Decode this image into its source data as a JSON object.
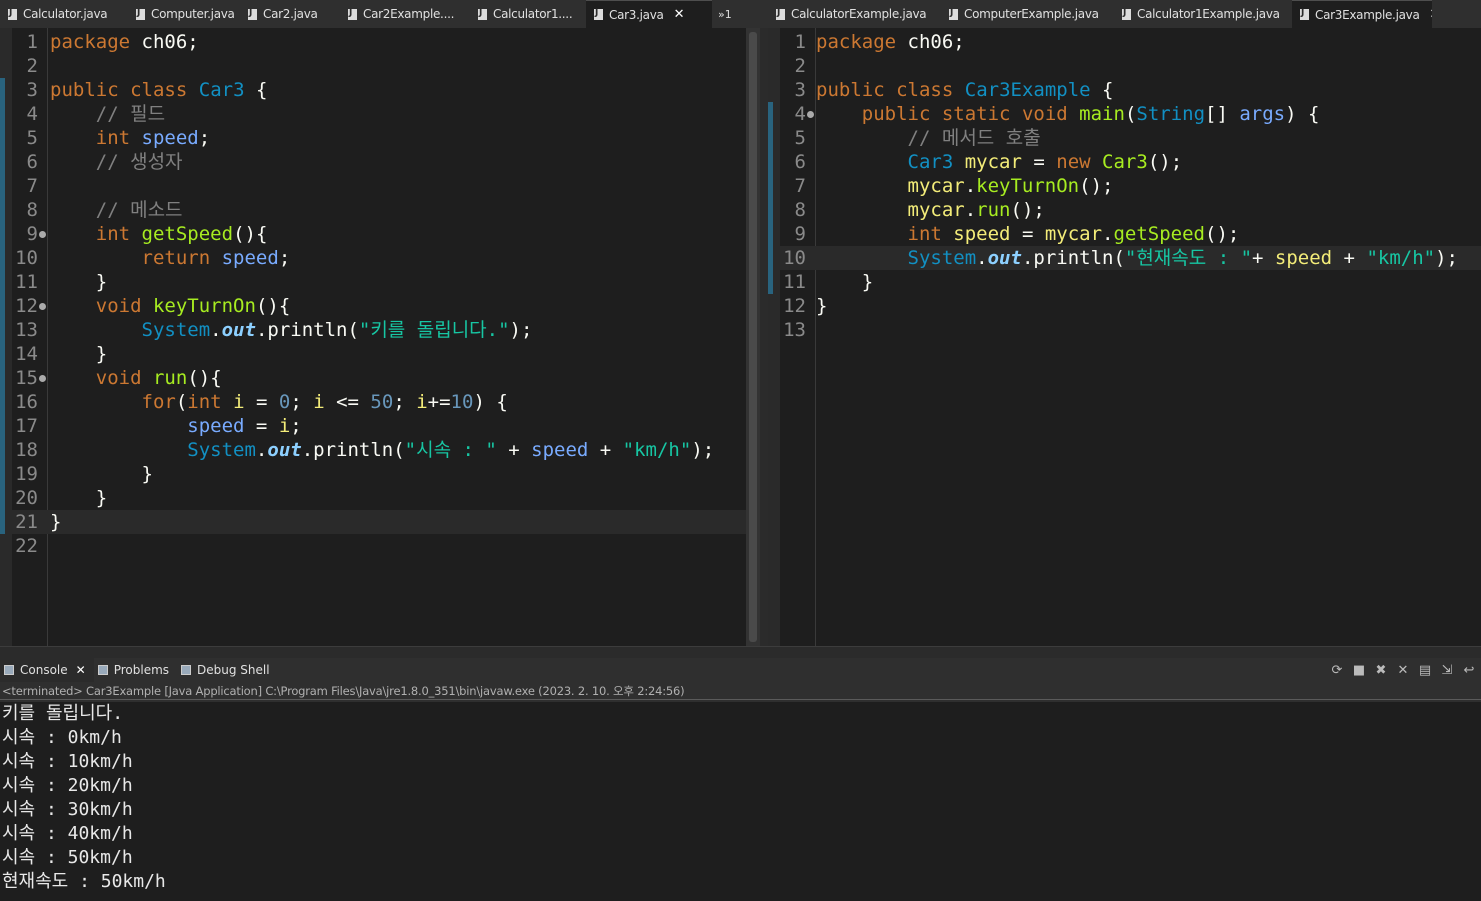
{
  "left_tabs": [
    {
      "label": "Calculator.java",
      "active": false
    },
    {
      "label": "Computer.java",
      "active": false
    },
    {
      "label": "Car2.java",
      "active": false
    },
    {
      "label": "Car2Example....",
      "active": false
    },
    {
      "label": "Calculator1....",
      "active": false
    },
    {
      "label": "Car3.java",
      "active": true
    }
  ],
  "left_more": "»1",
  "right_tabs": [
    {
      "label": "CalculatorExample.java",
      "active": false
    },
    {
      "label": "ComputerExample.java",
      "active": false
    },
    {
      "label": "Calculator1Example.java",
      "active": false
    },
    {
      "label": "Car3Example.java",
      "active": true
    }
  ],
  "left_editor": {
    "current_line": 21,
    "lines": [
      {
        "n": "1",
        "fold": false,
        "tokens": [
          [
            "k",
            "package"
          ],
          [
            "p",
            " ch06;"
          ]
        ]
      },
      {
        "n": "2",
        "fold": false,
        "tokens": []
      },
      {
        "n": "3",
        "fold": false,
        "tokens": [
          [
            "k",
            "public"
          ],
          [
            "p",
            " "
          ],
          [
            "k",
            "class"
          ],
          [
            "p",
            " "
          ],
          [
            "t",
            "Car3"
          ],
          [
            "p",
            " {"
          ]
        ]
      },
      {
        "n": "4",
        "fold": false,
        "tokens": [
          [
            "p",
            "    "
          ],
          [
            "c",
            "// 필드"
          ]
        ]
      },
      {
        "n": "5",
        "fold": false,
        "tokens": [
          [
            "p",
            "    "
          ],
          [
            "k",
            "int"
          ],
          [
            "p",
            " "
          ],
          [
            "f",
            "speed"
          ],
          [
            "p",
            ";"
          ]
        ]
      },
      {
        "n": "6",
        "fold": false,
        "tokens": [
          [
            "p",
            "    "
          ],
          [
            "c",
            "// 생성자"
          ]
        ]
      },
      {
        "n": "7",
        "fold": false,
        "tokens": []
      },
      {
        "n": "8",
        "fold": false,
        "tokens": [
          [
            "p",
            "    "
          ],
          [
            "c",
            "// 메소드"
          ]
        ]
      },
      {
        "n": "9",
        "fold": true,
        "tokens": [
          [
            "p",
            "    "
          ],
          [
            "k",
            "int"
          ],
          [
            "p",
            " "
          ],
          [
            "m",
            "getSpeed"
          ],
          [
            "p",
            "(){"
          ]
        ]
      },
      {
        "n": "10",
        "fold": false,
        "tokens": [
          [
            "p",
            "        "
          ],
          [
            "k",
            "return"
          ],
          [
            "p",
            " "
          ],
          [
            "f",
            "speed"
          ],
          [
            "p",
            ";"
          ]
        ]
      },
      {
        "n": "11",
        "fold": false,
        "tokens": [
          [
            "p",
            "    }"
          ]
        ]
      },
      {
        "n": "12",
        "fold": true,
        "tokens": [
          [
            "p",
            "    "
          ],
          [
            "k",
            "void"
          ],
          [
            "p",
            " "
          ],
          [
            "m",
            "keyTurnOn"
          ],
          [
            "p",
            "(){"
          ]
        ]
      },
      {
        "n": "13",
        "fold": false,
        "tokens": [
          [
            "p",
            "        "
          ],
          [
            "t",
            "System"
          ],
          [
            "p",
            "."
          ],
          [
            "st",
            "out"
          ],
          [
            "p",
            ".println("
          ],
          [
            "s",
            "\"키를 돌립니다.\""
          ],
          [
            "p",
            ");"
          ]
        ]
      },
      {
        "n": "14",
        "fold": false,
        "tokens": [
          [
            "p",
            "    }"
          ]
        ]
      },
      {
        "n": "15",
        "fold": true,
        "tokens": [
          [
            "p",
            "    "
          ],
          [
            "k",
            "void"
          ],
          [
            "p",
            " "
          ],
          [
            "m",
            "run"
          ],
          [
            "p",
            "(){"
          ]
        ]
      },
      {
        "n": "16",
        "fold": false,
        "tokens": [
          [
            "p",
            "        "
          ],
          [
            "k",
            "for"
          ],
          [
            "p",
            "("
          ],
          [
            "k",
            "int"
          ],
          [
            "p",
            " "
          ],
          [
            "lv",
            "i"
          ],
          [
            "p",
            " = "
          ],
          [
            "n",
            "0"
          ],
          [
            "p",
            "; "
          ],
          [
            "lv",
            "i"
          ],
          [
            "p",
            " <= "
          ],
          [
            "n",
            "50"
          ],
          [
            "p",
            "; "
          ],
          [
            "lv",
            "i"
          ],
          [
            "p",
            "+="
          ],
          [
            "n",
            "10"
          ],
          [
            "p",
            ") {"
          ]
        ]
      },
      {
        "n": "17",
        "fold": false,
        "tokens": [
          [
            "p",
            "            "
          ],
          [
            "f",
            "speed"
          ],
          [
            "p",
            " = "
          ],
          [
            "lv",
            "i"
          ],
          [
            "p",
            ";"
          ]
        ]
      },
      {
        "n": "18",
        "fold": false,
        "tokens": [
          [
            "p",
            "            "
          ],
          [
            "t",
            "System"
          ],
          [
            "p",
            "."
          ],
          [
            "st",
            "out"
          ],
          [
            "p",
            ".println("
          ],
          [
            "s",
            "\"시속 : \""
          ],
          [
            "p",
            " + "
          ],
          [
            "f",
            "speed"
          ],
          [
            "p",
            " + "
          ],
          [
            "s",
            "\"km/h\""
          ],
          [
            "p",
            ");"
          ]
        ]
      },
      {
        "n": "19",
        "fold": false,
        "tokens": [
          [
            "p",
            "        }"
          ]
        ]
      },
      {
        "n": "20",
        "fold": false,
        "tokens": [
          [
            "p",
            "    }"
          ]
        ]
      },
      {
        "n": "21",
        "fold": false,
        "tokens": [
          [
            "p",
            "}"
          ]
        ]
      },
      {
        "n": "22",
        "fold": false,
        "tokens": []
      }
    ]
  },
  "right_editor": {
    "current_line": 10,
    "lines": [
      {
        "n": "1",
        "fold": false,
        "tokens": [
          [
            "k",
            "package"
          ],
          [
            "p",
            " ch06;"
          ]
        ]
      },
      {
        "n": "2",
        "fold": false,
        "tokens": []
      },
      {
        "n": "3",
        "fold": false,
        "tokens": [
          [
            "k",
            "public"
          ],
          [
            "p",
            " "
          ],
          [
            "k",
            "class"
          ],
          [
            "p",
            " "
          ],
          [
            "t",
            "Car3Example"
          ],
          [
            "p",
            " {"
          ]
        ]
      },
      {
        "n": "4",
        "fold": true,
        "tokens": [
          [
            "p",
            "    "
          ],
          [
            "k",
            "public"
          ],
          [
            "p",
            " "
          ],
          [
            "k",
            "static"
          ],
          [
            "p",
            " "
          ],
          [
            "k",
            "void"
          ],
          [
            "p",
            " "
          ],
          [
            "m",
            "main"
          ],
          [
            "p",
            "("
          ],
          [
            "t",
            "String"
          ],
          [
            "p",
            "[] "
          ],
          [
            "f",
            "args"
          ],
          [
            "p",
            ") {"
          ]
        ]
      },
      {
        "n": "5",
        "fold": false,
        "tokens": [
          [
            "p",
            "        "
          ],
          [
            "c",
            "// 메서드 호출"
          ]
        ]
      },
      {
        "n": "6",
        "fold": false,
        "tokens": [
          [
            "p",
            "        "
          ],
          [
            "t",
            "Car3"
          ],
          [
            "p",
            " "
          ],
          [
            "lv",
            "mycar"
          ],
          [
            "p",
            " = "
          ],
          [
            "k",
            "new"
          ],
          [
            "p",
            " "
          ],
          [
            "m",
            "Car3"
          ],
          [
            "p",
            "();"
          ]
        ]
      },
      {
        "n": "7",
        "fold": false,
        "tokens": [
          [
            "p",
            "        "
          ],
          [
            "lv",
            "mycar"
          ],
          [
            "p",
            "."
          ],
          [
            "m",
            "keyTurnOn"
          ],
          [
            "p",
            "();"
          ]
        ]
      },
      {
        "n": "8",
        "fold": false,
        "tokens": [
          [
            "p",
            "        "
          ],
          [
            "lv",
            "mycar"
          ],
          [
            "p",
            "."
          ],
          [
            "m",
            "run"
          ],
          [
            "p",
            "();"
          ]
        ]
      },
      {
        "n": "9",
        "fold": false,
        "tokens": [
          [
            "p",
            "        "
          ],
          [
            "k",
            "int"
          ],
          [
            "p",
            " "
          ],
          [
            "lv",
            "speed"
          ],
          [
            "p",
            " = "
          ],
          [
            "lv",
            "mycar"
          ],
          [
            "p",
            "."
          ],
          [
            "m",
            "getSpeed"
          ],
          [
            "p",
            "();"
          ]
        ]
      },
      {
        "n": "10",
        "fold": false,
        "tokens": [
          [
            "p",
            "        "
          ],
          [
            "t",
            "System"
          ],
          [
            "p",
            "."
          ],
          [
            "st",
            "out"
          ],
          [
            "p",
            ".println("
          ],
          [
            "s",
            "\"현재속도 : \""
          ],
          [
            "p",
            "+ "
          ],
          [
            "lv",
            "speed"
          ],
          [
            "p",
            " + "
          ],
          [
            "s",
            "\"km/h\""
          ],
          [
            "p",
            ");"
          ]
        ]
      },
      {
        "n": "11",
        "fold": false,
        "tokens": [
          [
            "p",
            "    }"
          ]
        ]
      },
      {
        "n": "12",
        "fold": false,
        "tokens": [
          [
            "p",
            "}"
          ]
        ]
      },
      {
        "n": "13",
        "fold": false,
        "tokens": []
      }
    ]
  },
  "console": {
    "tabs": [
      {
        "label": "Console",
        "active": true
      },
      {
        "label": "Problems",
        "active": false
      },
      {
        "label": "Debug Shell",
        "active": false
      }
    ],
    "status": "<terminated> Car3Example [Java Application] C:\\Program Files\\Java\\jre1.8.0_351\\bin\\javaw.exe (2023. 2. 10. 오후 2:24:56)",
    "output": [
      "키를 돌립니다.",
      "시속 : 0km/h",
      "시속 : 10km/h",
      "시속 : 20km/h",
      "시속 : 30km/h",
      "시속 : 40km/h",
      "시속 : 50km/h",
      "현재속도 : 50km/h"
    ]
  }
}
